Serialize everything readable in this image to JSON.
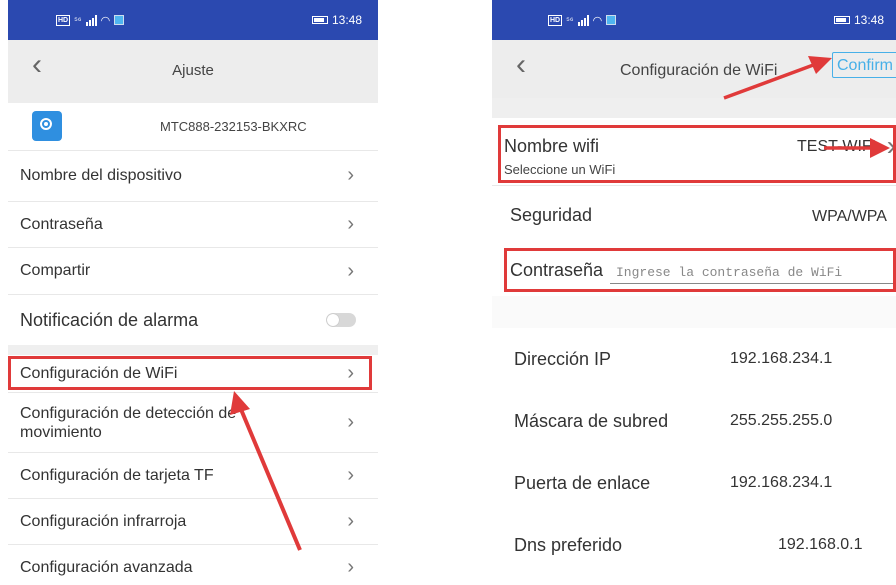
{
  "left": {
    "status": {
      "time": "13:48",
      "signal": "⁵⁶",
      "hd": "HD"
    },
    "header": {
      "back_glyph": "‹",
      "title": "Ajuste"
    },
    "device": {
      "id": "MTC888-232153-BKXRC"
    },
    "items": [
      {
        "label": "Nombre del dispositivo"
      },
      {
        "label": "Contraseña"
      },
      {
        "label": "Compartir"
      },
      {
        "label": "Notificación de alarma",
        "toggle": false
      },
      {
        "label": "Configuración de WiFi"
      },
      {
        "label": "Configuración de detección de movimiento"
      },
      {
        "label": "Configuración de tarjeta TF"
      },
      {
        "label": "Configuración infrarroja"
      },
      {
        "label": "Configuración avanzada"
      }
    ],
    "chevron": "›"
  },
  "right": {
    "status": {
      "time": "13:48",
      "signal": "⁵⁶",
      "hd": "HD"
    },
    "header": {
      "back_glyph": "‹",
      "title": "Configuración de WiFi",
      "confirm_label": "Confirm"
    },
    "wifi_name": {
      "label": "Nombre wifi",
      "hint": "Seleccione un WiFi",
      "value": "TEST-WIFI"
    },
    "security": {
      "label": "Seguridad",
      "value": "WPA/WPA"
    },
    "password": {
      "label": "Contraseña",
      "placeholder": "Ingrese la contraseña de WiFi"
    },
    "network": [
      {
        "label": "Dirección IP",
        "value": "192.168.234.1"
      },
      {
        "label": "Máscara de subred",
        "value": "255.255.255.0"
      },
      {
        "label": "Puerta de enlace",
        "value": "192.168.234.1"
      },
      {
        "label": "Dns preferido",
        "value": "192.168.0.1"
      }
    ],
    "chevron": "›"
  },
  "colors": {
    "statusbar": "#2b49b0",
    "highlight": "#e03a3a",
    "confirm": "#47b0e8"
  }
}
